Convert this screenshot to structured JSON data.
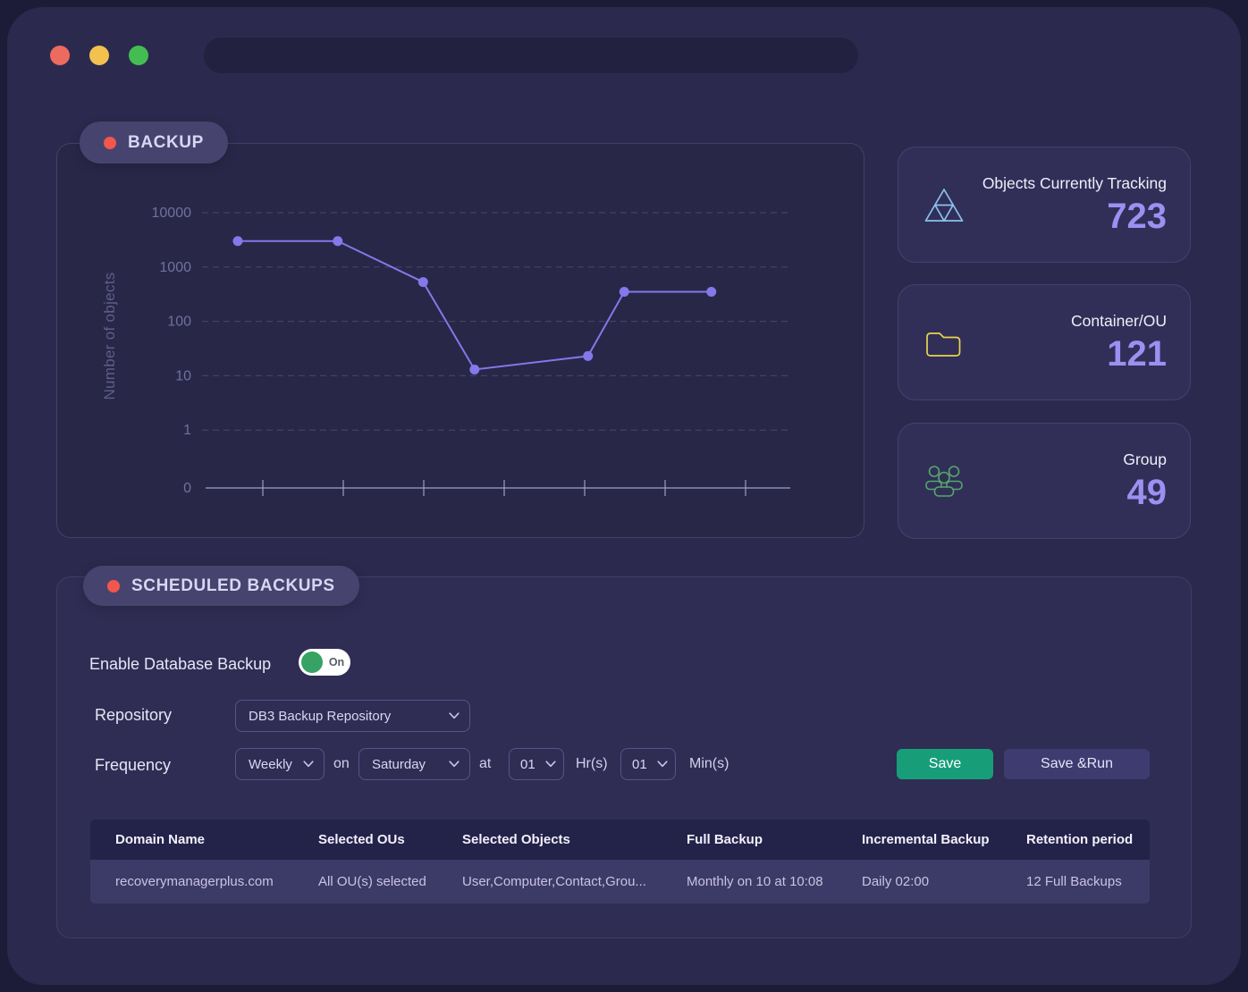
{
  "colors": {
    "accent_line": "#8478EA",
    "save_green": "#179E79",
    "section_dot_red": "#F2564D",
    "stat_number_purple": "#9C90F2",
    "toggle_on_green": "#36A364",
    "traffic_lights": [
      "#ED6A5E",
      "#F2C14E",
      "#43BD52"
    ]
  },
  "backup_section": {
    "title": "BACKUP"
  },
  "chart_data": {
    "type": "line",
    "title": "",
    "xlabel": "",
    "ylabel": "Number of objects",
    "y_scale": "log",
    "y_ticks": [
      "10000",
      "1000",
      "100",
      "10",
      "1",
      "0"
    ],
    "x_tick_count": 7,
    "grid": "horizontal-dashed",
    "legend": "none",
    "series": [
      {
        "name": "Number of objects",
        "values": [
          3000,
          3000,
          530,
          13,
          23,
          350,
          350
        ]
      }
    ],
    "x_fractions": [
      0.055,
      0.226,
      0.372,
      0.46,
      0.654,
      0.716,
      0.865
    ],
    "line_color": "#8478EA"
  },
  "stats": [
    {
      "label": "Objects Currently Tracking",
      "value": "723",
      "icon": "triangle-icon",
      "icon_color": "#8AC3EF"
    },
    {
      "label": "Container/OU",
      "value": "121",
      "icon": "folder-icon",
      "icon_color": "#E9D44C"
    },
    {
      "label": "Group",
      "value": "49",
      "icon": "group-icon",
      "icon_color": "#55A868"
    }
  ],
  "scheduled": {
    "title": "SCHEDULED BACKUPS",
    "enable_label": "Enable Database Backup",
    "toggle_state": "On",
    "repository_label": "Repository",
    "repository_value": "DB3 Backup Repository",
    "frequency_label": "Frequency",
    "frequency_value": "Weekly",
    "on_label": "on",
    "day_value": "Saturday",
    "at_label": "at",
    "hour_value": "01",
    "hour_unit": "Hr(s)",
    "minute_value": "01",
    "minute_unit": "Min(s)",
    "save_label": "Save",
    "save_run_label": "Save &Run",
    "table": {
      "headers": [
        "Domain Name",
        "Selected OUs",
        "Selected Objects",
        "Full Backup",
        "Incremental Backup",
        "Retention period"
      ],
      "rows": [
        [
          "recoverymanagerplus.com",
          "All OU(s) selected",
          "User,Computer,Contact,Grou...",
          "Monthly on 10 at 10:08",
          "Daily 02:00",
          "12 Full Backups"
        ]
      ]
    }
  }
}
